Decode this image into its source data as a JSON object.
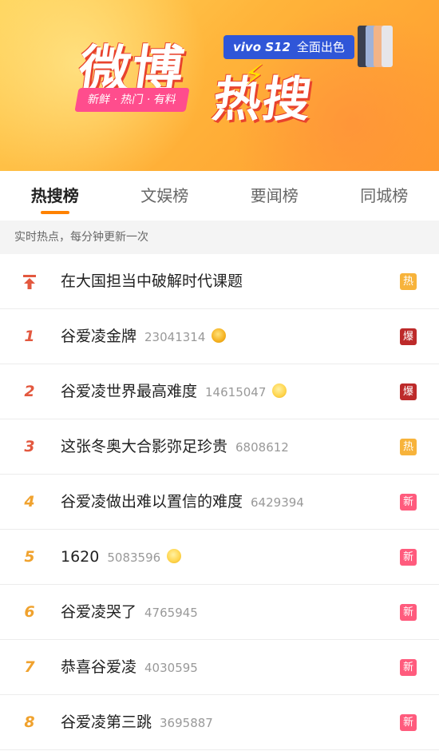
{
  "banner": {
    "title_part1": "微博",
    "title_part2": "热搜",
    "tagline": "新鲜 · 热门 · 有料",
    "ad_brand": "vivo S12",
    "ad_text": "全面出色"
  },
  "tabs": [
    {
      "label": "热搜榜",
      "active": true
    },
    {
      "label": "文娱榜",
      "active": false
    },
    {
      "label": "要闻榜",
      "active": false
    },
    {
      "label": "同城榜",
      "active": false
    }
  ],
  "subheader": "实时热点，每分钟更新一次",
  "items": [
    {
      "rank": "",
      "pinned": true,
      "title": "在大国担当中破解时代课题",
      "count": "",
      "emoji": "",
      "badge": "热",
      "badge_type": "hot"
    },
    {
      "rank": "1",
      "pinned": false,
      "title": "谷爱凌金牌",
      "count": "23041314",
      "emoji": "medal-icon",
      "badge": "爆",
      "badge_type": "boom"
    },
    {
      "rank": "2",
      "pinned": false,
      "title": "谷爱凌世界最高难度",
      "count": "14615047",
      "emoji": "crying-face-icon",
      "badge": "爆",
      "badge_type": "boom"
    },
    {
      "rank": "3",
      "pinned": false,
      "title": "这张冬奥大合影弥足珍贵",
      "count": "6808612",
      "emoji": "",
      "badge": "热",
      "badge_type": "hot"
    },
    {
      "rank": "4",
      "pinned": false,
      "title": "谷爱凌做出难以置信的难度",
      "count": "6429394",
      "emoji": "",
      "badge": "新",
      "badge_type": "new"
    },
    {
      "rank": "5",
      "pinned": false,
      "title": "1620",
      "count": "5083596",
      "emoji": "crying-face-icon",
      "badge": "新",
      "badge_type": "new"
    },
    {
      "rank": "6",
      "pinned": false,
      "title": "谷爱凌哭了",
      "count": "4765945",
      "emoji": "",
      "badge": "新",
      "badge_type": "new"
    },
    {
      "rank": "7",
      "pinned": false,
      "title": "恭喜谷爱凌",
      "count": "4030595",
      "emoji": "",
      "badge": "新",
      "badge_type": "new"
    },
    {
      "rank": "8",
      "pinned": false,
      "title": "谷爱凌第三跳",
      "count": "3695887",
      "emoji": "",
      "badge": "新",
      "badge_type": "new"
    }
  ],
  "colors": {
    "accent": "#ff8200",
    "rank_top": "#e3583f",
    "rank_other": "#f0a22e",
    "badge_hot": "#f7b33b",
    "badge_boom": "#bd2a2a",
    "badge_new": "#ff5b7d"
  }
}
